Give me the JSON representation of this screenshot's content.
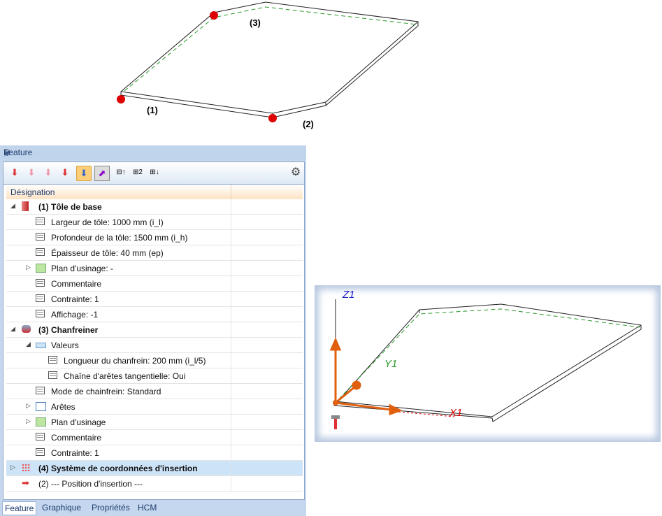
{
  "drawing": {
    "labels": [
      "(1)",
      "(2)",
      "(3)"
    ]
  },
  "panel": {
    "title": "Feature",
    "column_header": "Désignation",
    "rows": [
      {
        "label": "(1) Tôle de base",
        "level": 0,
        "bold": true,
        "expander": "open",
        "icon": "sheet-metal-icon"
      },
      {
        "label": "Largeur de tôle: 1000 mm (i_l)",
        "level": 1,
        "icon": "parameter-icon"
      },
      {
        "label": "Profondeur de la tôle: 1500 mm (i_h)",
        "level": 1,
        "icon": "parameter-icon"
      },
      {
        "label": "Épaisseur de tôle: 40 mm (ep)",
        "level": 1,
        "icon": "parameter-icon"
      },
      {
        "label": "Plan d'usinage: -",
        "level": 1,
        "expander": "closed",
        "icon": "plane-icon"
      },
      {
        "label": "Commentaire",
        "level": 1,
        "icon": "parameter-icon"
      },
      {
        "label": "Contrainte: 1",
        "level": 1,
        "icon": "parameter-icon"
      },
      {
        "label": "Affichage: -1",
        "level": 1,
        "icon": "parameter-icon"
      },
      {
        "label": "(3) Chanfreiner",
        "level": 0,
        "bold": true,
        "expander": "open",
        "icon": "chamfer-icon"
      },
      {
        "label": "Valeurs",
        "level": 1,
        "expander": "open",
        "icon": "values-icon"
      },
      {
        "label": "Longueur du chanfrein: 200 mm (i_l/5)",
        "level": 2,
        "icon": "parameter-icon"
      },
      {
        "label": "Chaîne d'arêtes tangentielle: Oui",
        "level": 2,
        "icon": "parameter-icon"
      },
      {
        "label": "Mode de chainfrein: Standard",
        "level": 1,
        "icon": "parameter-icon"
      },
      {
        "label": "Arêtes",
        "level": 1,
        "expander": "closed",
        "icon": "edges-icon"
      },
      {
        "label": "Plan d'usinage",
        "level": 1,
        "expander": "closed",
        "icon": "plane-icon"
      },
      {
        "label": "Commentaire",
        "level": 1,
        "icon": "parameter-icon"
      },
      {
        "label": "Contrainte: 1",
        "level": 1,
        "icon": "parameter-icon"
      },
      {
        "label": "(4) Système de coordonnées d'insertion",
        "level": 0,
        "bold": true,
        "expander": "closed",
        "icon": "coordinate-system-icon",
        "selected": true
      },
      {
        "label": "(2) --- Position  d'insertion ---",
        "level": 0,
        "bold": false,
        "icon": "arrow-icon"
      }
    ],
    "tabs": [
      "Feature",
      "Graphique",
      "Propriétés",
      "HCM"
    ],
    "active_tab": "Feature"
  },
  "viewport": {
    "axes": {
      "z": "Z1",
      "y": "Y1",
      "x": "X1"
    }
  }
}
